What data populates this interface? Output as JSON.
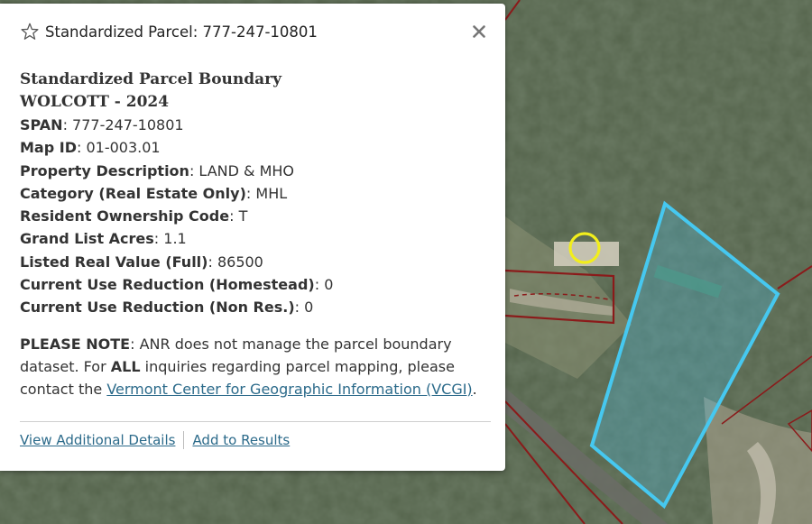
{
  "popup": {
    "title": "Standardized Parcel: 777-247-10801",
    "heading_line1": "Standardized Parcel Boundary",
    "heading_line2": "WOLCOTT - 2024",
    "fields": [
      {
        "label": "SPAN",
        "value": "777-247-10801"
      },
      {
        "label": "Map ID",
        "value": "01-003.01"
      },
      {
        "label": "Property Description",
        "value": "LAND & MHO"
      },
      {
        "label": "Category (Real Estate Only)",
        "value": "MHL"
      },
      {
        "label": "Resident Ownership Code",
        "value": "T"
      },
      {
        "label": "Grand List Acres",
        "value": "1.1"
      },
      {
        "label": "Listed Real Value (Full)",
        "value": "86500"
      },
      {
        "label": "Current Use Reduction (Homestead)",
        "value": "0"
      },
      {
        "label": "Current Use Reduction (Non Res.)",
        "value": "0"
      }
    ],
    "note_label": "PLEASE NOTE",
    "note_text_1": ": ANR does not manage the parcel boundary dataset. For ",
    "note_bold": "ALL",
    "note_text_2": " inquiries regarding parcel mapping, please contact the ",
    "note_link": "Vermont Center for Geographic Information (VCGI)",
    "note_end": ".",
    "actions": {
      "view_details": "View Additional Details",
      "add_results": "Add to Results"
    }
  },
  "icons": {
    "favorite": "star-outline-icon",
    "close": "close-icon"
  },
  "colors": {
    "selected_parcel": "#46c8f0",
    "parcel_lines": "#8b1a1a",
    "highlight_circle": "#f2ee1c",
    "link": "#2b6a8a"
  }
}
